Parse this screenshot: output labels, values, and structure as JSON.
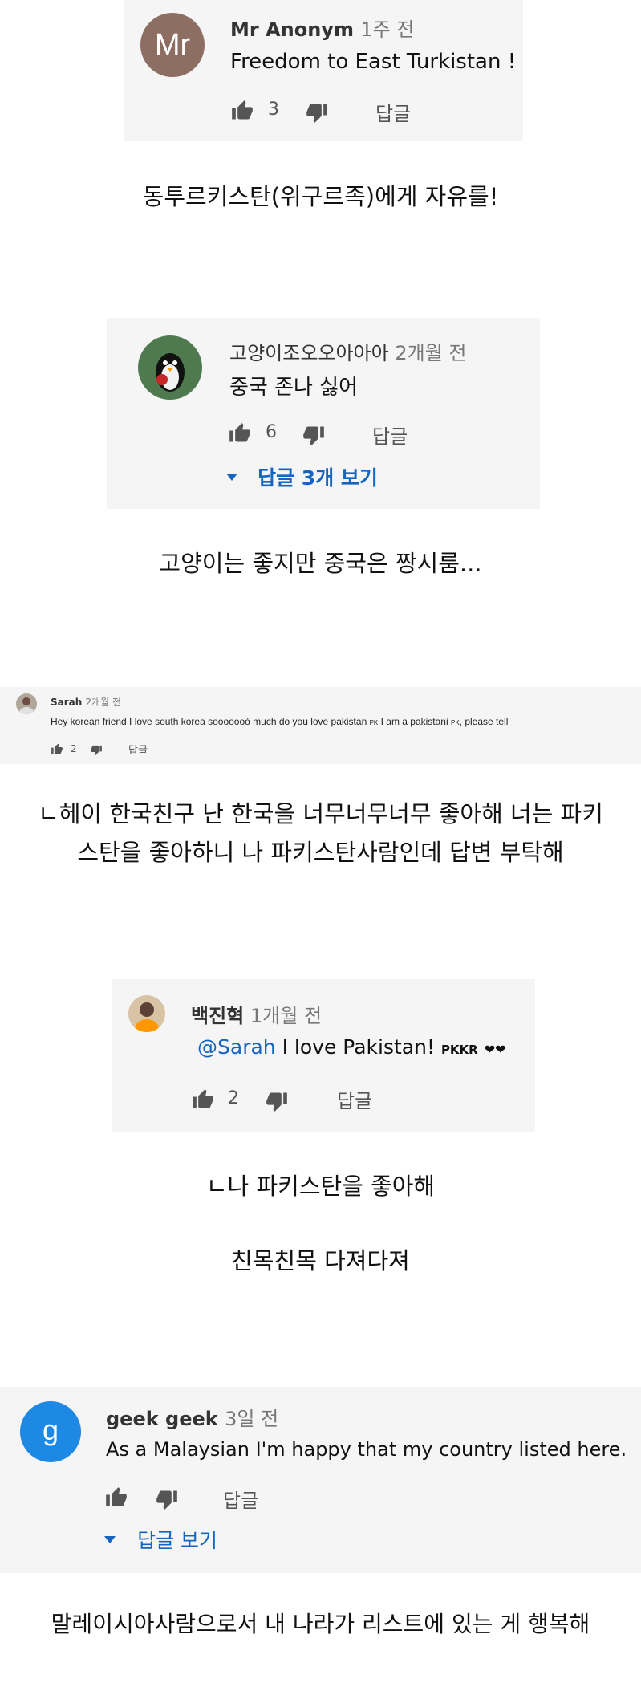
{
  "comments": [
    {
      "author": "Mr Anonym",
      "time": "1주 전",
      "avatar_text": "Mr",
      "avatar_color": "#8d6e63",
      "text": "Freedom to East Turkistan !",
      "likes": "3",
      "reply_label": "답글"
    },
    {
      "author": "고양이조오오아아아",
      "time": "2개월 전",
      "avatar_icon": "penguin-avatar-icon",
      "text": "중국 존나 싫어",
      "likes": "6",
      "reply_label": "답글",
      "view_replies": "답글 3개 보기"
    },
    {
      "author": "Sarah",
      "time": "2개월 전",
      "avatar_icon": "photo-avatar-icon",
      "text": "Hey korean friend  I love south korea sooooooò much do you love pakistan",
      "text_flag1": "PK",
      "text_mid": " I am a pakistani ",
      "text_flag2": "PK",
      "text_end": ", please tell",
      "likes": "2",
      "reply_label": "답글"
    },
    {
      "author": "백진혁",
      "time": "1개월 전",
      "avatar_icon": "photo-avatar-icon",
      "mention": "@Sarah",
      "text": " I love Pakistan! ",
      "text_tail": "PKKR",
      "likes": "2",
      "reply_label": "답글"
    },
    {
      "author": "geek geek",
      "time": "3일 전",
      "avatar_text": "g",
      "avatar_color": "#1e88e5",
      "text": "As a Malaysian I'm happy that my country listed here.",
      "reply_label": "답글",
      "view_replies": "답글 보기"
    }
  ],
  "captions": {
    "c1": "동투르키스탄(위구르족)에게 자유를!",
    "c2": "고양이는 좋지만 중국은 짱시룸...",
    "c3_line1": "ㄴ헤이 한국친구 난 한국을 너무너무너무 좋아해 너는 파키",
    "c3_line2": "스탄을 좋아하니 나 파키스탄사람인데 답변 부탁해",
    "c4": "ㄴ나 파키스탄을 좋아해",
    "c5": "친목친목 다져다져",
    "c6": "말레이시아사람으로서 내 나라가 리스트에 있는 게 행복해"
  },
  "colors": {
    "card_bg": "#f5f5f5",
    "link_blue": "#1565c0",
    "icon_gray": "#555555"
  }
}
